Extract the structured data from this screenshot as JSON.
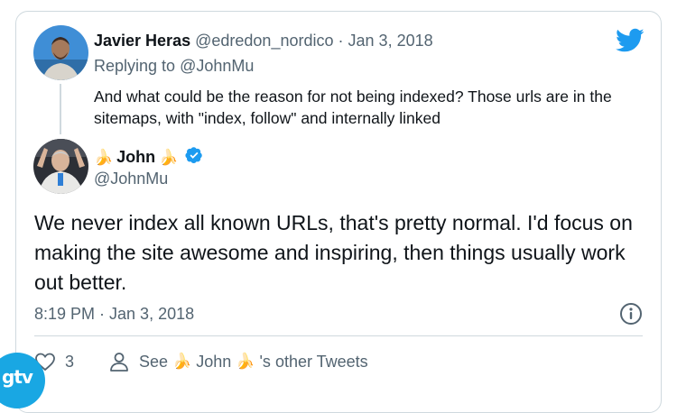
{
  "reply": {
    "author_name": "Javier Heras",
    "author_handle": "@edredon_nordico",
    "separator": "·",
    "date": "Jan 3, 2018",
    "replying_label": "Replying to",
    "replying_to": "@JohnMu",
    "text": "And what could be the reason for not being indexed? Those urls are in the sitemaps, with \"index, follow\" and internally linked"
  },
  "tweet": {
    "author_emoji_left": "🍌",
    "author_name": "John",
    "author_emoji_right": "🍌",
    "author_handle": "@JohnMu",
    "text": "We never index all known URLs, that's pretty normal. I'd focus on making the site awesome and inspiring, then things usually work out better.",
    "timestamp": "8:19 PM · Jan 3, 2018"
  },
  "actions": {
    "like_count": "3",
    "see_prefix": "See",
    "see_emoji_left": "🍌",
    "see_name": "John",
    "see_emoji_right": "🍌",
    "see_suffix": "'s other Tweets"
  },
  "logo": {
    "text": "gtv"
  },
  "icons": {
    "brand": "twitter-bird-icon",
    "verified": "verified-badge-icon",
    "info": "info-icon",
    "like": "heart-icon",
    "profile": "person-icon"
  },
  "colors": {
    "twitter_blue": "#1d9bf0",
    "text": "#0f1419",
    "muted": "#536471",
    "border": "#cfd9de",
    "logo": "#19a7e3"
  }
}
